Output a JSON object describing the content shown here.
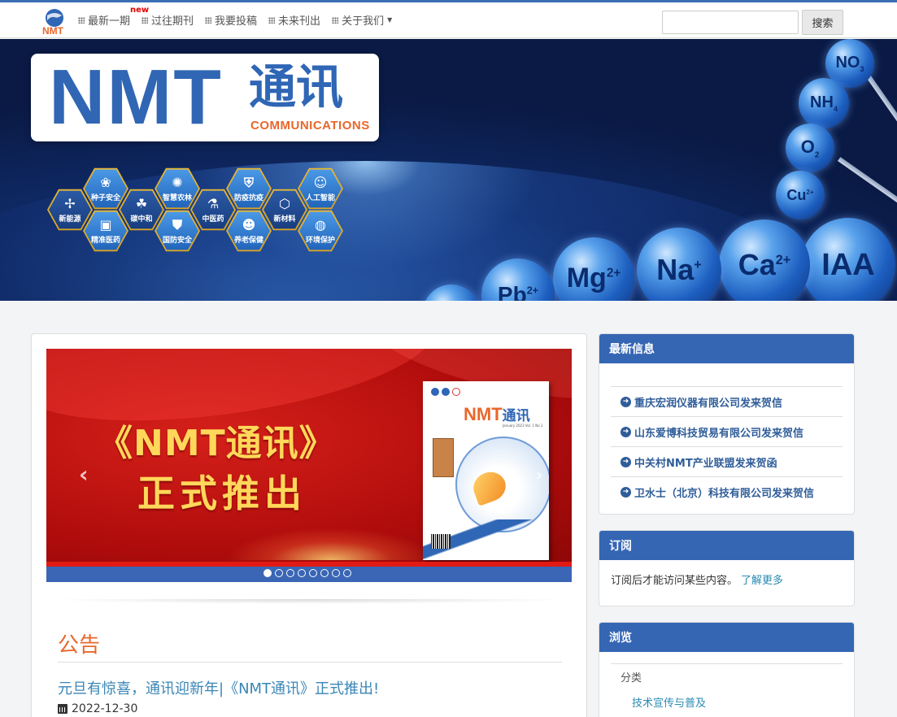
{
  "nav": {
    "logo_text": "NMT",
    "new_badge": "new",
    "items": [
      {
        "label": "最新一期"
      },
      {
        "label": "过往期刊"
      },
      {
        "label": "我要投稿"
      },
      {
        "label": "未来刊出"
      },
      {
        "label": "关于我们"
      }
    ],
    "search_button": "搜索",
    "search_value": ""
  },
  "banner": {
    "title_latin": "NMT",
    "title_cn": "通讯",
    "title_en": "COMMUNICATIONS",
    "hexagons": [
      "种子安全",
      "智慧农林",
      "防疫抗疫",
      "人工智能",
      "新能源",
      "碳中和",
      "中医药",
      "新材料",
      "精准医药",
      "国防安全",
      "养老保健",
      "环境保护"
    ],
    "spheres": [
      "NO3",
      "NH4",
      "O2",
      "Cu2+",
      "IAA",
      "Ca2+",
      "Na+",
      "Mg2+",
      "Pb2+"
    ]
  },
  "carousel": {
    "headline1": "《NMT通讯》",
    "headline2": "正式推出",
    "journal_title_latin": "NMT",
    "journal_title_cn": "通讯",
    "journal_sub": "January 2023 Vol. 1 No.1",
    "slide_count": 8,
    "active_index": 0
  },
  "notice": {
    "heading": "公告",
    "title": "元旦有惊喜，通讯迎新年|《NMT通讯》正式推出!",
    "date": "2022-12-30"
  },
  "sidebar": {
    "news": {
      "heading": "最新信息",
      "items": [
        "重庆宏润仪器有限公司发来贺信",
        "山东爱博科技贸易有限公司发来贺信",
        "中关村NMT产业联盟发来贺函",
        "卫水士（北京）科技有限公司发来贺信"
      ]
    },
    "subscribe": {
      "heading": "订阅",
      "text": "订阅后才能访问某些内容。",
      "link": "了解更多"
    },
    "browse": {
      "heading": "浏览",
      "category": "分类",
      "sub_item": "技术宣传与普及"
    }
  },
  "colors": {
    "brand_blue": "#3566b4",
    "accent_orange": "#e8672b",
    "link_teal": "#2a8ab2",
    "slide_red": "#b00c0c"
  }
}
